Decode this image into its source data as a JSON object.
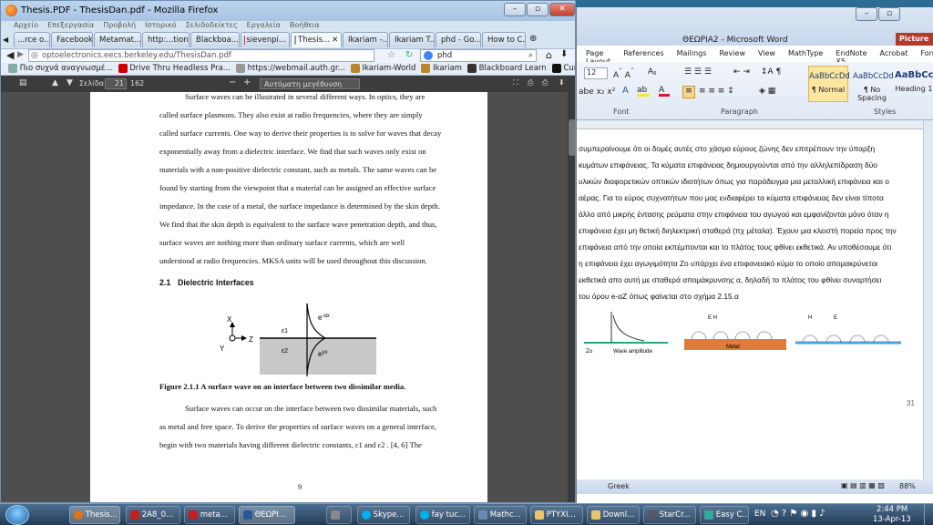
{
  "firefox": {
    "title": "Thesis.PDF - ThesisDan.pdf - Mozilla Firefox",
    "tabs": [
      "...rce o...",
      "Facebook",
      "Metamat...",
      "http:...tions",
      "Blackboa...",
      "sievenpi...",
      "Thesis...",
      "Ikariam -...",
      "Ikariam T...",
      "phd - Go...",
      "How to C..."
    ],
    "url": "optoelectronics.eecs.berkeley.edu/ThesisDan.pdf",
    "search": "phd",
    "bookmarks": [
      "Πιο συχνά αναγνωσμέ...",
      "Drive Thru Headless Pra...",
      "https://webmail.auth.gr...",
      "Ikariam-World",
      "Ikariam",
      "Blackboard Learn",
      "Curiosity Finds That Anc..."
    ],
    "pdf_page_label": "Σελίδα:",
    "pdf_page": "21",
    "pdf_page_total": "162",
    "pdf_zoom": "Αυτόματη μεγέθυνση"
  },
  "pdf": {
    "lines": [
      "Surface waves can be illustrated in several different ways. In optics, they are",
      "called surface plasmons. They also exist at radio frequencies, where they are simply",
      "called surface currents. One way to derive their properties is to solve for waves that decay",
      "exponentially away from a dielectric interface. We find that such waves only exist on",
      "materials with a non-positive dielectric constant, such as metals. The same waves can be",
      "found by starting from the viewpoint that a material can be assigned an effective surface",
      "impedance. In the case of a metal, the surface impedance is determined by the skin depth.",
      "We find that the skin depth is equivalent to the surface wave penetration depth, and thus,",
      "surface waves are nothing more than ordinary surface currents, which are well",
      "understood at radio frequencies. MKSA units will be used throughout this discussion."
    ],
    "section_num": "2.1",
    "section_title": "Dielectric Interfaces",
    "fig_labels": {
      "x": "X",
      "z": "Z",
      "y": "Y",
      "e1": "ε1",
      "e2": "ε2",
      "top_exp": "e",
      "top_exp_sup": "-αx",
      "bot_exp": "e",
      "bot_exp_sup": "γx"
    },
    "caption": "Figure 2.1.1 A surface wave on an interface between two dissimilar media.",
    "lines2": [
      "Surface waves can occur on the interface between two dissimilar materials, such",
      "as metal and free space. To derive the properties of surface waves on a general interface,",
      "begin with two materials having different dielectric constants,  ε1  and  ε2 . [4, 6] The"
    ],
    "page_number": "9"
  },
  "word": {
    "title": "ΘΕΩΡΙΑ2 - Microsoft Word",
    "tab_right": "Picture To...",
    "ribbon_tabs": [
      "Page Layout",
      "References",
      "Mailings",
      "Review",
      "View",
      "MathType",
      "EndNote X5",
      "Acrobat",
      "Format"
    ],
    "font_size": "12",
    "groups": [
      "Font",
      "Paragraph",
      "Styles"
    ],
    "styles": [
      {
        "sample": "AaBbCcDd",
        "name": "¶ Normal"
      },
      {
        "sample": "AaBbCcDd",
        "name": "¶ No Spacing"
      },
      {
        "sample": "AaBbCc",
        "name": "Heading 1"
      }
    ],
    "lines": [
      "συμπεραίνουμε ότι οι δομές αυτές στο χάσμα εύρους ζώνης δεν επιτρέπουν την ύπαρξη",
      "κυμάτων επιφάνειας.  Τα  κύματα επιφάνειας δημιουργούνται από την αλληλεπίδραση δύο",
      "υλικών διαφορετικών οπτικών ιδιοτήτων όπως για παράδειγμα μια μεταλλική επιφάνεια και ο",
      "αέρας. Για το εύρος συχνοτήτων που μας ενδιαφέρει τα κύματα επιφάνειας δεν είναι τίποτα",
      "άλλο από μικρής έντασης ρεύματα στην επιφάνεια του αγωγού και εμφανίζονται μόνο όταν η",
      "επιφάνεια έχει μη θετική διηλεκτρική σταθερά (πχ μέταλα). Έχουν μια κλειστή πορεία προς την",
      "επιφάνεια από την οποία εκπέμπονται και το πλάτος τους φθίνει εκθετικά. Αν υποθέσουμε ότι",
      "η επιφάνεια έχει αγωγιμότητα Zo υπάρχει ένα επιφανειακό κύμα το οποίο απομακρύνεται",
      "εκθετικά απο αυτή με σταθερά απομάκρυνσης α, δηλαδή το πλάτος του φθίνει συναρτήσει",
      "του όρου e-αΖ όπως φαίνεται στο σχήμα 2.15.α"
    ],
    "fig_labels": [
      "Zo",
      "Wave amplitude",
      "E H",
      "Metal",
      "H",
      "E"
    ],
    "page_number": "31",
    "language": "Greek",
    "zoom": "88%"
  },
  "taskbar": {
    "items": [
      "Thesis...",
      "2A8_0...",
      "meta...",
      "ΘΕΩΡΙ...",
      "",
      "Skype...",
      "fay tuc...",
      "Mathc...",
      "PTYXI...",
      "Downl...",
      "StarCr...",
      "Easy C..."
    ],
    "lang": "EN",
    "time": "2:44 PM",
    "date": "13-Apr-13"
  },
  "colors": {
    "accent": "#2b579a",
    "metal": "#e07b39",
    "highlight": "#f5e23a"
  }
}
